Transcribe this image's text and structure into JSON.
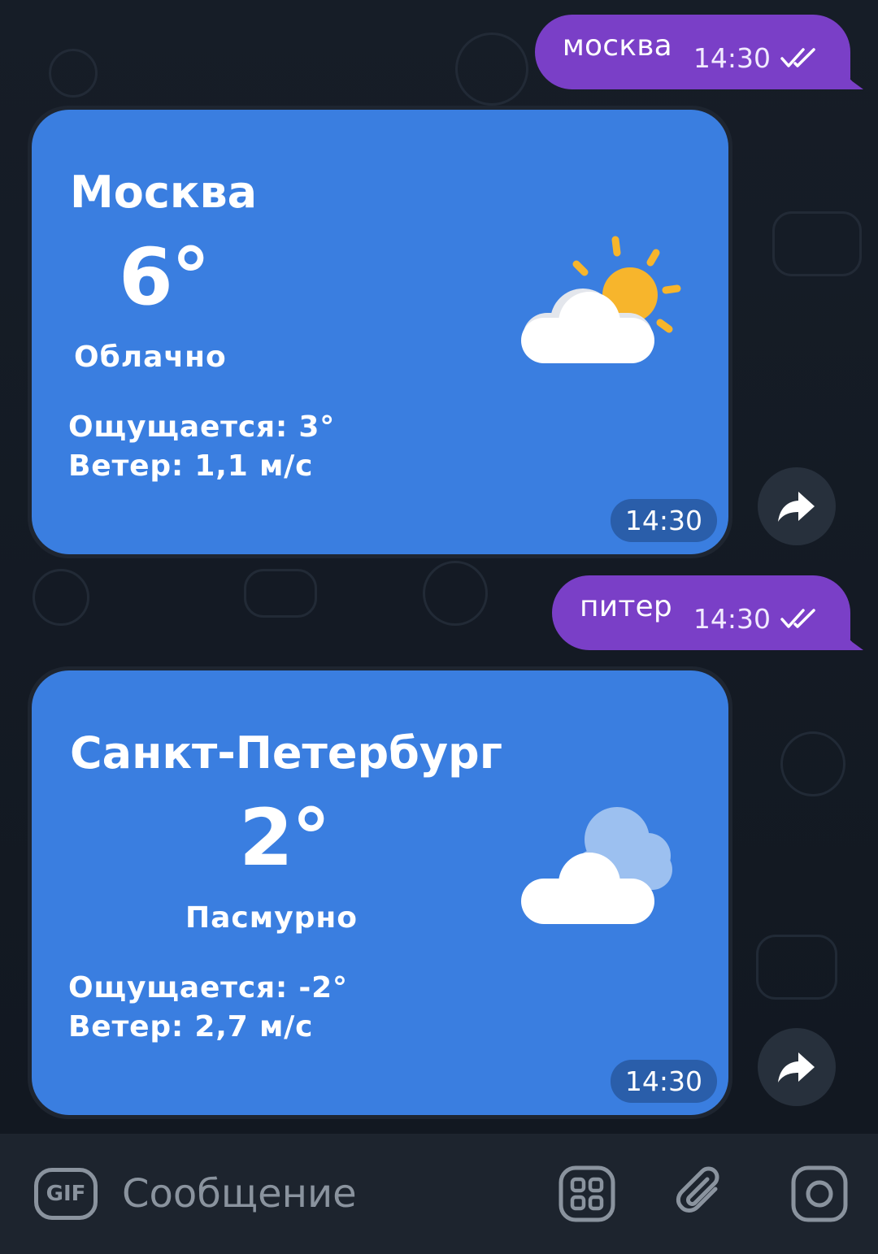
{
  "chat": {
    "messages": [
      {
        "type": "outgoing",
        "text": "москва",
        "time": "14:30",
        "status_icon": "double-check-icon"
      },
      {
        "type": "weather_card",
        "city": "Москва",
        "temp": "6°",
        "condition": "Облачно",
        "feels": "Ощущается: 3°",
        "wind": "Ветер: 1,1 м/с",
        "time": "14:30",
        "icon": "partly-sunny-icon"
      },
      {
        "type": "outgoing",
        "text": "питер",
        "time": "14:30",
        "status_icon": "double-check-icon"
      },
      {
        "type": "weather_card",
        "city": "Санкт-Петербург",
        "temp": "2°",
        "condition": "Пасмурно",
        "feels": "Ощущается: -2°",
        "wind": "Ветер: 2,7 м/с",
        "time": "14:30",
        "icon": "overcast-icon"
      }
    ]
  },
  "input_bar": {
    "gif_label": "GIF",
    "placeholder": "Сообщение",
    "icons": [
      "gif-icon",
      "stickers-grid-icon",
      "paperclip-icon",
      "camera-icon"
    ]
  },
  "colors": {
    "outgoing_bubble": "#7a3fc7",
    "weather_card": "#3a7ee0",
    "background": "#141a23"
  }
}
